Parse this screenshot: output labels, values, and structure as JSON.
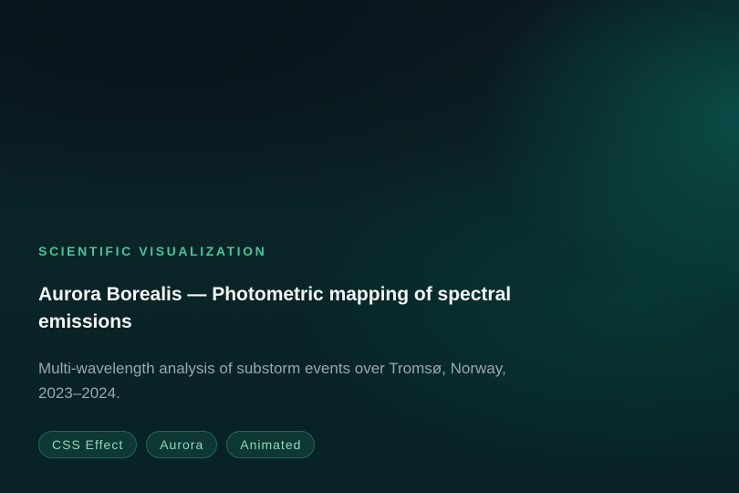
{
  "card": {
    "eyebrow": "SCIENTIFIC VISUALIZATION",
    "title": "Aurora Borealis — Photometric mapping of spectral emissions",
    "description": "Multi-wavelength analysis of substorm events over Tromsø, Norway, 2023–2024.",
    "tags": [
      "CSS Effect",
      "Aurora",
      "Animated"
    ]
  },
  "colors": {
    "accent": "#43c79a",
    "title": "#f3f6f7",
    "description": "#9aa7ad",
    "tag_text": "#8fd9bd",
    "tag_border": "#1d6a58"
  }
}
